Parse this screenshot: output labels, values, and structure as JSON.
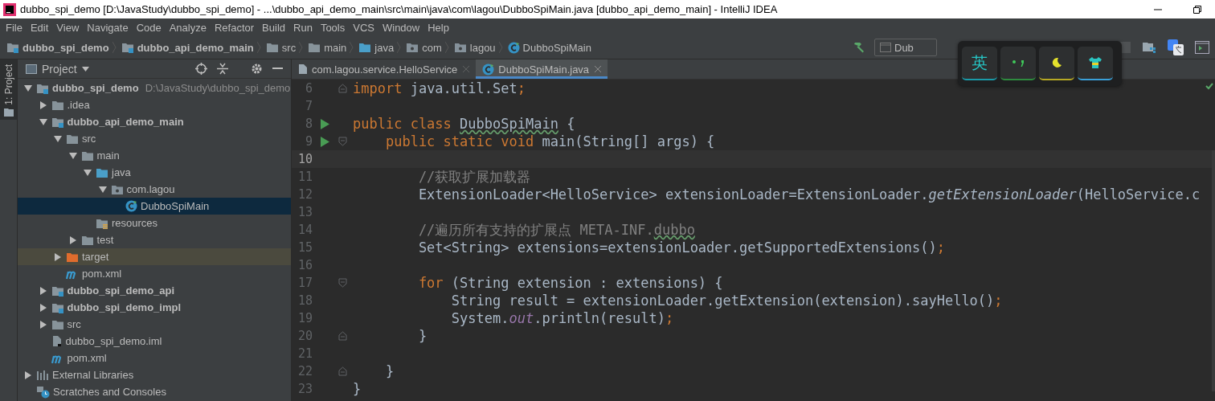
{
  "window": {
    "title": "dubbo_spi_demo [D:\\JavaStudy\\dubbo_spi_demo] - ...\\dubbo_api_demo_main\\src\\main\\java\\com\\lagou\\DubboSpiMain.java [dubbo_api_demo_main] - IntelliJ IDEA"
  },
  "menu": [
    "File",
    "Edit",
    "View",
    "Navigate",
    "Code",
    "Analyze",
    "Refactor",
    "Build",
    "Run",
    "Tools",
    "VCS",
    "Window",
    "Help"
  ],
  "breadcrumbs": [
    {
      "label": "dubbo_spi_demo",
      "kind": "module"
    },
    {
      "label": "dubbo_api_demo_main",
      "kind": "module"
    },
    {
      "label": "src",
      "kind": "folder"
    },
    {
      "label": "main",
      "kind": "folder"
    },
    {
      "label": "java",
      "kind": "source"
    },
    {
      "label": "com",
      "kind": "package"
    },
    {
      "label": "lagou",
      "kind": "package"
    },
    {
      "label": "DubboSpiMain",
      "kind": "class"
    }
  ],
  "toolbar": {
    "run_config": "Dub"
  },
  "ime_toolbar": {
    "buttons": [
      {
        "kind": "text",
        "label": "英"
      },
      {
        "kind": "punctuation"
      },
      {
        "kind": "moon"
      },
      {
        "kind": "shirt"
      }
    ]
  },
  "side_strip": {
    "label": "1: Project"
  },
  "project_panel": {
    "title": "Project",
    "tree": [
      {
        "label": "dubbo_spi_demo",
        "path": "D:\\JavaStudy\\dubbo_spi_demo",
        "kind": "module",
        "expanded": true,
        "selected": false,
        "children": [
          {
            "label": ".idea",
            "kind": "folder",
            "expanded": false,
            "selected": false
          },
          {
            "label": "dubbo_api_demo_main",
            "kind": "module",
            "expanded": true,
            "selected": false,
            "children": [
              {
                "label": "src",
                "kind": "folder",
                "expanded": true,
                "selected": false,
                "children": [
                  {
                    "label": "main",
                    "kind": "folder",
                    "expanded": true,
                    "selected": false,
                    "children": [
                      {
                        "label": "java",
                        "kind": "source",
                        "expanded": true,
                        "selected": false,
                        "children": [
                          {
                            "label": "com.lagou",
                            "kind": "package",
                            "expanded": true,
                            "selected": false,
                            "children": [
                              {
                                "label": "DubboSpiMain",
                                "kind": "class",
                                "selected": true
                              }
                            ]
                          }
                        ]
                      },
                      {
                        "label": "resources",
                        "kind": "resources",
                        "selected": false
                      }
                    ]
                  },
                  {
                    "label": "test",
                    "kind": "folder",
                    "expanded": false,
                    "selected": false
                  }
                ]
              },
              {
                "label": "target",
                "kind": "excluded",
                "expanded": false,
                "selected": false
              },
              {
                "label": "pom.xml",
                "kind": "maven",
                "selected": false
              }
            ]
          },
          {
            "label": "dubbo_spi_demo_api",
            "kind": "module",
            "expanded": false,
            "selected": false
          },
          {
            "label": "dubbo_spi_demo_impl",
            "kind": "module",
            "expanded": false,
            "selected": false
          },
          {
            "label": "src",
            "kind": "folder",
            "expanded": false,
            "selected": false
          },
          {
            "label": "dubbo_spi_demo.iml",
            "kind": "iml",
            "selected": false
          },
          {
            "label": "pom.xml",
            "kind": "maven",
            "selected": false
          }
        ]
      },
      {
        "label": "External Libraries",
        "kind": "libraries",
        "expanded": false,
        "selected": false
      },
      {
        "label": "Scratches and Consoles",
        "kind": "scratches",
        "selected": false
      }
    ]
  },
  "editor": {
    "tabs": [
      {
        "label": "com.lagou.service.HelloService",
        "selected": false
      },
      {
        "label": "DubboSpiMain.java",
        "selected": true
      }
    ],
    "lines": [
      {
        "number": "6",
        "run": false,
        "fold": {
          "kind": "end"
        },
        "current": false,
        "tokens": [
          {
            "kind": "keyword",
            "text": "import"
          },
          {
            "kind": "plain",
            "text": " java.util.Set"
          },
          {
            "kind": "keyword",
            "text": ";"
          }
        ]
      },
      {
        "number": "7",
        "run": false,
        "current": false
      },
      {
        "number": "8",
        "run": true,
        "current": false,
        "tokens": [
          {
            "kind": "keyword",
            "text": "public class "
          },
          {
            "kind": "typo",
            "text": "DubboSpiMain"
          },
          {
            "kind": "plain",
            "text": " {"
          }
        ]
      },
      {
        "number": "9",
        "run": true,
        "fold": {
          "kind": "start"
        },
        "current": false,
        "tokens": [
          {
            "kind": "keyword",
            "text": "    public static void "
          },
          {
            "kind": "plain",
            "text": "main(String[] args) {"
          }
        ]
      },
      {
        "number": "10",
        "run": false,
        "current": true
      },
      {
        "number": "11",
        "run": false,
        "current": false,
        "tokens": [
          {
            "kind": "comment",
            "text": "        //获取扩展加载器"
          }
        ]
      },
      {
        "number": "12",
        "run": false,
        "current": false,
        "tokens": [
          {
            "kind": "plain",
            "text": "        ExtensionLoader<HelloService> extensionLoader=ExtensionLoader."
          },
          {
            "kind": "static-method",
            "text": "getExtensionLoader"
          },
          {
            "kind": "plain",
            "text": "(HelloService.c"
          }
        ]
      },
      {
        "number": "13",
        "run": false,
        "current": false
      },
      {
        "number": "14",
        "run": false,
        "current": false,
        "tokens": [
          {
            "kind": "comment",
            "text": "        //遍历所有支持的扩展点 META-INF."
          },
          {
            "kind": "comment-typo",
            "text": "dubbo"
          }
        ]
      },
      {
        "number": "15",
        "run": false,
        "current": false,
        "tokens": [
          {
            "kind": "plain",
            "text": "        Set<String> extensions=extensionLoader.getSupportedExtensions()"
          },
          {
            "kind": "keyword",
            "text": ";"
          }
        ]
      },
      {
        "number": "16",
        "run": false,
        "current": false
      },
      {
        "number": "17",
        "run": false,
        "fold": {
          "kind": "start"
        },
        "current": false,
        "tokens": [
          {
            "kind": "keyword",
            "text": "        for"
          },
          {
            "kind": "plain",
            "text": " (String extension : extensions) {"
          }
        ]
      },
      {
        "number": "18",
        "run": false,
        "current": false,
        "tokens": [
          {
            "kind": "plain",
            "text": "            String result = extensionLoader.getExtension(extension).sayHello()"
          },
          {
            "kind": "keyword",
            "text": ";"
          }
        ]
      },
      {
        "number": "19",
        "run": false,
        "current": false,
        "tokens": [
          {
            "kind": "plain",
            "text": "            System."
          },
          {
            "kind": "static-field",
            "text": "out"
          },
          {
            "kind": "plain",
            "text": ".println(result)"
          },
          {
            "kind": "keyword",
            "text": ";"
          }
        ]
      },
      {
        "number": "20",
        "run": false,
        "fold": {
          "kind": "end"
        },
        "current": false,
        "tokens": [
          {
            "kind": "plain",
            "text": "        }"
          }
        ]
      },
      {
        "number": "21",
        "run": false,
        "current": false
      },
      {
        "number": "22",
        "run": false,
        "fold": {
          "kind": "end"
        },
        "current": false,
        "tokens": [
          {
            "kind": "plain",
            "text": "    }"
          }
        ]
      },
      {
        "number": "23",
        "run": false,
        "current": false,
        "tokens": [
          {
            "kind": "plain",
            "text": "}"
          }
        ]
      }
    ]
  }
}
